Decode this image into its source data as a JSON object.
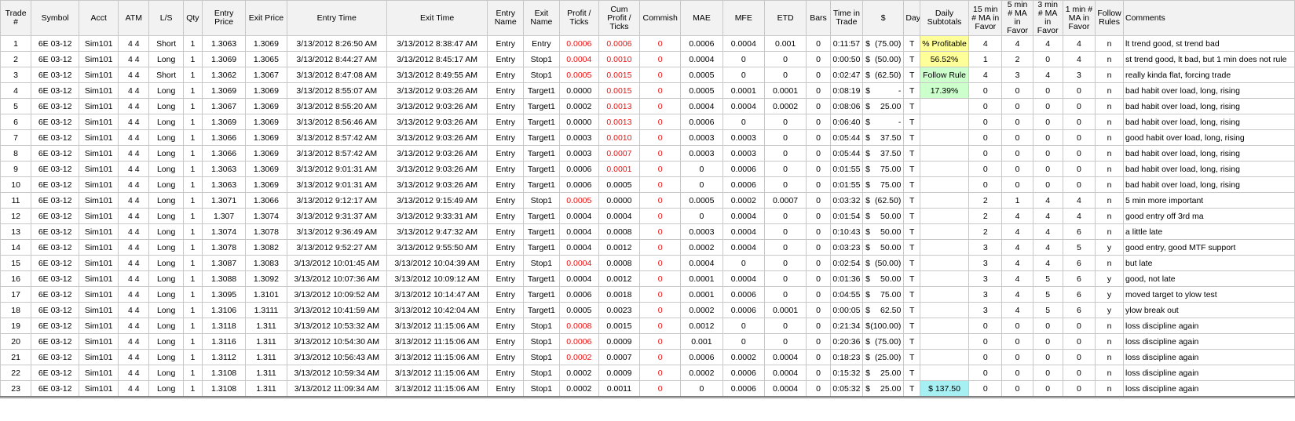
{
  "columns": [
    "Trade #",
    "Symbol",
    "Acct",
    "ATM",
    "L/S",
    "Qty",
    "Entry Price",
    "Exit Price",
    "Entry Time",
    "Exit Time",
    "Entry Name",
    "Exit Name",
    "Profit / Ticks",
    "Cum Profit / Ticks",
    "Commish",
    "MAE",
    "MFE",
    "ETD",
    "Bars",
    "Time in Trade",
    "$",
    "Day",
    "Daily Subtotals",
    "15 min # MA in Favor",
    "5 min # MA in Favor",
    "3 min # MA in Favor",
    "1 min # MA in Favor",
    "Follow Rules",
    "Comments"
  ],
  "colors": {
    "red_text": "#ee1111",
    "yellow_cell": "#ffff99",
    "green_cell": "#ccffcc",
    "cyan_cell": "#a6f0f4",
    "header_bg": "#f2f2f2",
    "grid": "#c8c8c8"
  },
  "rows": [
    [
      "1",
      "6E 03-12",
      "Sim101",
      "4 4",
      "Short",
      "1",
      "1.3063",
      "1.3069",
      "3/13/2012 8:26:50 AM",
      "3/13/2012 8:38:47 AM",
      "Entry",
      "Entry",
      "0.0006",
      "0.0006",
      "0",
      "0.0006",
      "0.0004",
      "0.001",
      "0",
      "0:11:57",
      "(75.00)",
      "T",
      "% Profitable",
      "4",
      "4",
      "4",
      "4",
      "n",
      "lt trend good, st trend bad"
    ],
    [
      "2",
      "6E 03-12",
      "Sim101",
      "4 4",
      "Long",
      "1",
      "1.3069",
      "1.3065",
      "3/13/2012 8:44:27 AM",
      "3/13/2012 8:45:17 AM",
      "Entry",
      "Stop1",
      "0.0004",
      "0.0010",
      "0",
      "0.0004",
      "0",
      "0",
      "0",
      "0:00:50",
      "(50.00)",
      "T",
      "56.52%",
      "1",
      "2",
      "0",
      "4",
      "n",
      "st trend good, lt bad, but 1 min does not rule"
    ],
    [
      "3",
      "6E 03-12",
      "Sim101",
      "4 4",
      "Short",
      "1",
      "1.3062",
      "1.3067",
      "3/13/2012 8:47:08 AM",
      "3/13/2012 8:49:55 AM",
      "Entry",
      "Stop1",
      "0.0005",
      "0.0015",
      "0",
      "0.0005",
      "0",
      "0",
      "0",
      "0:02:47",
      "(62.50)",
      "T",
      "Follow Rule",
      "4",
      "3",
      "4",
      "3",
      "n",
      "really kinda flat, forcing trade"
    ],
    [
      "4",
      "6E 03-12",
      "Sim101",
      "4 4",
      "Long",
      "1",
      "1.3069",
      "1.3069",
      "3/13/2012 8:55:07 AM",
      "3/13/2012 9:03:26 AM",
      "Entry",
      "Target1",
      "0.0000",
      "0.0015",
      "0",
      "0.0005",
      "0.0001",
      "0.0001",
      "0",
      "0:08:19",
      "-",
      "T",
      "17.39%",
      "0",
      "0",
      "0",
      "0",
      "n",
      "bad habit over load, long, rising"
    ],
    [
      "5",
      "6E 03-12",
      "Sim101",
      "4 4",
      "Long",
      "1",
      "1.3067",
      "1.3069",
      "3/13/2012 8:55:20 AM",
      "3/13/2012 9:03:26 AM",
      "Entry",
      "Target1",
      "0.0002",
      "0.0013",
      "0",
      "0.0004",
      "0.0004",
      "0.0002",
      "0",
      "0:08:06",
      "25.00",
      "T",
      "",
      "0",
      "0",
      "0",
      "0",
      "n",
      "bad habit over load, long, rising"
    ],
    [
      "6",
      "6E 03-12",
      "Sim101",
      "4 4",
      "Long",
      "1",
      "1.3069",
      "1.3069",
      "3/13/2012 8:56:46 AM",
      "3/13/2012 9:03:26 AM",
      "Entry",
      "Target1",
      "0.0000",
      "0.0013",
      "0",
      "0.0006",
      "0",
      "0",
      "0",
      "0:06:40",
      "-",
      "T",
      "",
      "0",
      "0",
      "0",
      "0",
      "n",
      "bad habit over load, long, rising"
    ],
    [
      "7",
      "6E 03-12",
      "Sim101",
      "4 4",
      "Long",
      "1",
      "1.3066",
      "1.3069",
      "3/13/2012 8:57:42 AM",
      "3/13/2012 9:03:26 AM",
      "Entry",
      "Target1",
      "0.0003",
      "0.0010",
      "0",
      "0.0003",
      "0.0003",
      "0",
      "0",
      "0:05:44",
      "37.50",
      "T",
      "",
      "0",
      "0",
      "0",
      "0",
      "n",
      "good habit over load, long, rising"
    ],
    [
      "8",
      "6E 03-12",
      "Sim101",
      "4 4",
      "Long",
      "1",
      "1.3066",
      "1.3069",
      "3/13/2012 8:57:42 AM",
      "3/13/2012 9:03:26 AM",
      "Entry",
      "Target1",
      "0.0003",
      "0.0007",
      "0",
      "0.0003",
      "0.0003",
      "0",
      "0",
      "0:05:44",
      "37.50",
      "T",
      "",
      "0",
      "0",
      "0",
      "0",
      "n",
      "bad habit over load, long, rising"
    ],
    [
      "9",
      "6E 03-12",
      "Sim101",
      "4 4",
      "Long",
      "1",
      "1.3063",
      "1.3069",
      "3/13/2012 9:01:31 AM",
      "3/13/2012 9:03:26 AM",
      "Entry",
      "Target1",
      "0.0006",
      "0.0001",
      "0",
      "0",
      "0.0006",
      "0",
      "0",
      "0:01:55",
      "75.00",
      "T",
      "",
      "0",
      "0",
      "0",
      "0",
      "n",
      "bad habit over load, long, rising"
    ],
    [
      "10",
      "6E 03-12",
      "Sim101",
      "4 4",
      "Long",
      "1",
      "1.3063",
      "1.3069",
      "3/13/2012 9:01:31 AM",
      "3/13/2012 9:03:26 AM",
      "Entry",
      "Target1",
      "0.0006",
      "0.0005",
      "0",
      "0",
      "0.0006",
      "0",
      "0",
      "0:01:55",
      "75.00",
      "T",
      "",
      "0",
      "0",
      "0",
      "0",
      "n",
      "bad habit over load, long, rising"
    ],
    [
      "11",
      "6E 03-12",
      "Sim101",
      "4 4",
      "Long",
      "1",
      "1.3071",
      "1.3066",
      "3/13/2012 9:12:17 AM",
      "3/13/2012 9:15:49 AM",
      "Entry",
      "Stop1",
      "0.0005",
      "0.0000",
      "0",
      "0.0005",
      "0.0002",
      "0.0007",
      "0",
      "0:03:32",
      "(62.50)",
      "T",
      "",
      "2",
      "1",
      "4",
      "4",
      "n",
      "5 min more important"
    ],
    [
      "12",
      "6E 03-12",
      "Sim101",
      "4 4",
      "Long",
      "1",
      "1.307",
      "1.3074",
      "3/13/2012 9:31:37 AM",
      "3/13/2012 9:33:31 AM",
      "Entry",
      "Target1",
      "0.0004",
      "0.0004",
      "0",
      "0",
      "0.0004",
      "0",
      "0",
      "0:01:54",
      "50.00",
      "T",
      "",
      "2",
      "4",
      "4",
      "4",
      "n",
      "good entry off 3rd ma"
    ],
    [
      "13",
      "6E 03-12",
      "Sim101",
      "4 4",
      "Long",
      "1",
      "1.3074",
      "1.3078",
      "3/13/2012 9:36:49 AM",
      "3/13/2012 9:47:32 AM",
      "Entry",
      "Target1",
      "0.0004",
      "0.0008",
      "0",
      "0.0003",
      "0.0004",
      "0",
      "0",
      "0:10:43",
      "50.00",
      "T",
      "",
      "2",
      "4",
      "4",
      "6",
      "n",
      "a little late"
    ],
    [
      "14",
      "6E 03-12",
      "Sim101",
      "4 4",
      "Long",
      "1",
      "1.3078",
      "1.3082",
      "3/13/2012 9:52:27 AM",
      "3/13/2012 9:55:50 AM",
      "Entry",
      "Target1",
      "0.0004",
      "0.0012",
      "0",
      "0.0002",
      "0.0004",
      "0",
      "0",
      "0:03:23",
      "50.00",
      "T",
      "",
      "3",
      "4",
      "4",
      "5",
      "y",
      "good entry, good MTF support"
    ],
    [
      "15",
      "6E 03-12",
      "Sim101",
      "4 4",
      "Long",
      "1",
      "1.3087",
      "1.3083",
      "3/13/2012 10:01:45 AM",
      "3/13/2012 10:04:39 AM",
      "Entry",
      "Stop1",
      "0.0004",
      "0.0008",
      "0",
      "0.0004",
      "0",
      "0",
      "0",
      "0:02:54",
      "(50.00)",
      "T",
      "",
      "3",
      "4",
      "4",
      "6",
      "n",
      "but late"
    ],
    [
      "16",
      "6E 03-12",
      "Sim101",
      "4 4",
      "Long",
      "1",
      "1.3088",
      "1.3092",
      "3/13/2012 10:07:36 AM",
      "3/13/2012 10:09:12 AM",
      "Entry",
      "Target1",
      "0.0004",
      "0.0012",
      "0",
      "0.0001",
      "0.0004",
      "0",
      "0",
      "0:01:36",
      "50.00",
      "T",
      "",
      "3",
      "4",
      "5",
      "6",
      "y",
      "good, not late"
    ],
    [
      "17",
      "6E 03-12",
      "Sim101",
      "4 4",
      "Long",
      "1",
      "1.3095",
      "1.3101",
      "3/13/2012 10:09:52 AM",
      "3/13/2012 10:14:47 AM",
      "Entry",
      "Target1",
      "0.0006",
      "0.0018",
      "0",
      "0.0001",
      "0.0006",
      "0",
      "0",
      "0:04:55",
      "75.00",
      "T",
      "",
      "3",
      "4",
      "5",
      "6",
      "y",
      "moved target to ylow test"
    ],
    [
      "18",
      "6E 03-12",
      "Sim101",
      "4 4",
      "Long",
      "1",
      "1.3106",
      "1.3111",
      "3/13/2012 10:41:59 AM",
      "3/13/2012 10:42:04 AM",
      "Entry",
      "Target1",
      "0.0005",
      "0.0023",
      "0",
      "0.0002",
      "0.0006",
      "0.0001",
      "0",
      "0:00:05",
      "62.50",
      "T",
      "",
      "3",
      "4",
      "5",
      "6",
      "y",
      "ylow break out"
    ],
    [
      "19",
      "6E 03-12",
      "Sim101",
      "4 4",
      "Long",
      "1",
      "1.3118",
      "1.311",
      "3/13/2012 10:53:32 AM",
      "3/13/2012 11:15:06 AM",
      "Entry",
      "Stop1",
      "0.0008",
      "0.0015",
      "0",
      "0.0012",
      "0",
      "0",
      "0",
      "0:21:34",
      "(100.00)",
      "T",
      "",
      "0",
      "0",
      "0",
      "0",
      "n",
      "loss discipline again"
    ],
    [
      "20",
      "6E 03-12",
      "Sim101",
      "4 4",
      "Long",
      "1",
      "1.3116",
      "1.311",
      "3/13/2012 10:54:30 AM",
      "3/13/2012 11:15:06 AM",
      "Entry",
      "Stop1",
      "0.0006",
      "0.0009",
      "0",
      "0.001",
      "0",
      "0",
      "0",
      "0:20:36",
      "(75.00)",
      "T",
      "",
      "0",
      "0",
      "0",
      "0",
      "n",
      "loss discipline again"
    ],
    [
      "21",
      "6E 03-12",
      "Sim101",
      "4 4",
      "Long",
      "1",
      "1.3112",
      "1.311",
      "3/13/2012 10:56:43 AM",
      "3/13/2012 11:15:06 AM",
      "Entry",
      "Stop1",
      "0.0002",
      "0.0007",
      "0",
      "0.0006",
      "0.0002",
      "0.0004",
      "0",
      "0:18:23",
      "(25.00)",
      "T",
      "",
      "0",
      "0",
      "0",
      "0",
      "n",
      "loss discipline again"
    ],
    [
      "22",
      "6E 03-12",
      "Sim101",
      "4 4",
      "Long",
      "1",
      "1.3108",
      "1.311",
      "3/13/2012 10:59:34 AM",
      "3/13/2012 11:15:06 AM",
      "Entry",
      "Stop1",
      "0.0002",
      "0.0009",
      "0",
      "0.0002",
      "0.0006",
      "0.0004",
      "0",
      "0:15:32",
      "25.00",
      "T",
      "",
      "0",
      "0",
      "0",
      "0",
      "n",
      "loss discipline again"
    ],
    [
      "23",
      "6E 03-12",
      "Sim101",
      "4 4",
      "Long",
      "1",
      "1.3108",
      "1.311",
      "3/13/2012 11:09:34 AM",
      "3/13/2012 11:15:06 AM",
      "Entry",
      "Stop1",
      "0.0002",
      "0.0011",
      "0",
      "0",
      "0.0006",
      "0.0004",
      "0",
      "0:05:32",
      "25.00",
      "T",
      "$   137.50",
      "0",
      "0",
      "0",
      "0",
      "n",
      "loss discipline again"
    ]
  ],
  "red_profit_rows": [
    1,
    2,
    3,
    11,
    15,
    19,
    20,
    21
  ],
  "red_cum_rows": [
    1,
    2,
    3,
    4,
    5,
    6,
    7,
    8,
    9
  ],
  "subtotal_styles": {
    "1": "yellow",
    "2": "yellow",
    "3": "green",
    "4": "green",
    "23": "cyan"
  }
}
